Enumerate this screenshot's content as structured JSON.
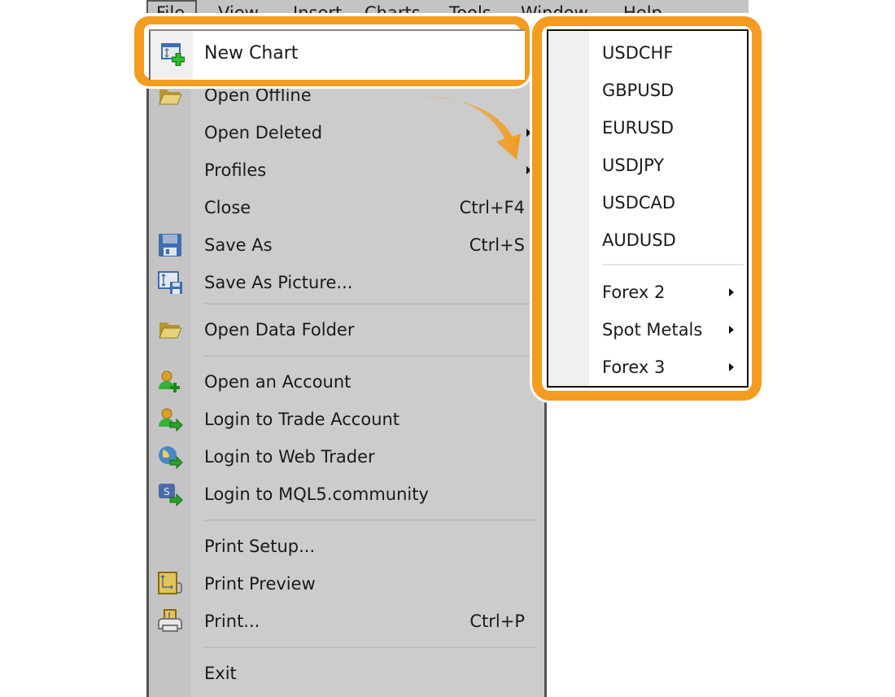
{
  "menubar": {
    "items": [
      "File",
      "View",
      "Insert",
      "Charts",
      "Tools",
      "Window",
      "Help"
    ]
  },
  "file_menu": {
    "highlighted": {
      "label": "New Chart",
      "icon": "new-chart-icon"
    },
    "items": [
      {
        "label": "Open Offline",
        "icon": "folder-icon",
        "shortcut": "",
        "submenu": false
      },
      {
        "label": "Open Deleted",
        "icon": "",
        "shortcut": "",
        "submenu": true
      },
      {
        "label": "Profiles",
        "icon": "",
        "shortcut": "",
        "submenu": true
      },
      {
        "label": "Close",
        "icon": "",
        "shortcut": "Ctrl+F4",
        "submenu": false
      },
      {
        "label": "Save As",
        "icon": "floppy-disk-icon",
        "shortcut": "Ctrl+S",
        "submenu": false
      },
      {
        "label": "Save As Picture...",
        "icon": "save-picture-icon",
        "shortcut": "",
        "submenu": false
      },
      {
        "label": "Open Data Folder",
        "icon": "folder-icon",
        "shortcut": "",
        "submenu": false
      },
      {
        "label": "Open an Account",
        "icon": "user-add-icon",
        "shortcut": "",
        "submenu": false
      },
      {
        "label": "Login to Trade Account",
        "icon": "user-login-icon",
        "shortcut": "",
        "submenu": false
      },
      {
        "label": "Login to Web Trader",
        "icon": "globe-login-icon",
        "shortcut": "",
        "submenu": false
      },
      {
        "label": "Login to MQL5.community",
        "icon": "mql5-login-icon",
        "shortcut": "",
        "submenu": false
      },
      {
        "label": "Print Setup...",
        "icon": "",
        "shortcut": "",
        "submenu": false
      },
      {
        "label": "Print Preview",
        "icon": "print-preview-icon",
        "shortcut": "",
        "submenu": false
      },
      {
        "label": "Print...",
        "icon": "printer-icon",
        "shortcut": "Ctrl+P",
        "submenu": false
      },
      {
        "label": "Exit",
        "icon": "",
        "shortcut": "",
        "submenu": false
      }
    ]
  },
  "symbol_submenu": {
    "symbols": [
      "USDCHF",
      "GBPUSD",
      "EURUSD",
      "USDJPY",
      "USDCAD",
      "AUDUSD"
    ],
    "groups": [
      "Forex 2",
      "Spot Metals",
      "Forex 3"
    ]
  },
  "colors": {
    "callout": "#f39c20",
    "menu_bg": "#cccccc",
    "submenu_bg": "#ffffff"
  }
}
